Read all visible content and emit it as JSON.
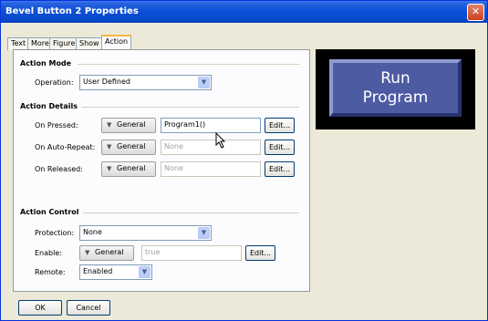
{
  "window": {
    "title": "Bevel Button 2 Properties",
    "close_glyph": "✕"
  },
  "tabs": [
    {
      "label": "Text",
      "active": false
    },
    {
      "label": "More",
      "active": false
    },
    {
      "label": "Figure",
      "active": false
    },
    {
      "label": "Show",
      "active": false
    },
    {
      "label": "Action",
      "active": true
    }
  ],
  "action_mode": {
    "section": "Action Mode",
    "operation_label": "Operation:",
    "operation_value": "User Defined"
  },
  "action_details": {
    "section": "Action Details",
    "rows": [
      {
        "label": "On Pressed:",
        "button": "General",
        "value": "Program1()",
        "disabled": false,
        "edit": "Edit..."
      },
      {
        "label": "On Auto-Repeat:",
        "button": "General",
        "value": "None",
        "disabled": true,
        "edit": "Edit..."
      },
      {
        "label": "On Released:",
        "button": "General",
        "value": "None",
        "disabled": true,
        "edit": "Edit..."
      }
    ]
  },
  "action_control": {
    "section": "Action Control",
    "protection_label": "Protection:",
    "protection_value": "None",
    "enable_label": "Enable:",
    "enable_button": "General",
    "enable_value": "true",
    "enable_edit": "Edit...",
    "remote_label": "Remote:",
    "remote_value": "Enabled"
  },
  "preview": {
    "line1": "Run",
    "line2": "Program",
    "fill": "#4d5ba3"
  },
  "footer": {
    "ok": "OK",
    "cancel": "Cancel"
  },
  "colors": {
    "title_bar": "#0a4fd6",
    "dialog": "#ece9d8",
    "tab_highlight": "#f9b641"
  }
}
